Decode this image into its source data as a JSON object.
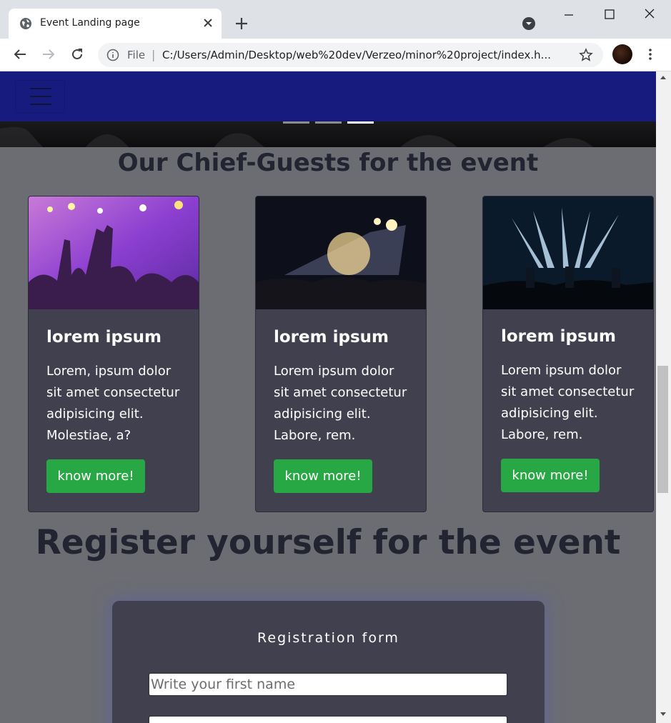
{
  "browser": {
    "tab_title": "Event Landing page",
    "omnibox_scheme": "File",
    "omnibox_url": "C:/Users/Admin/Desktop/web%20dev/Verzeo/minor%20project/index.h..."
  },
  "page": {
    "chief_guests_title": "Our Chief-Guests for the event",
    "cards": [
      {
        "title": "lorem ipsum",
        "text": "Lorem, ipsum dolor sit amet consectetur adipisicing elit. Molestiae, a?",
        "button": "know more!",
        "image": "concert-hands-purple-lights"
      },
      {
        "title": "lorem ipsum",
        "text": "Lorem ipsum dolor sit amet consectetur adipisicing elit. Labore, rem.",
        "button": "know more!",
        "image": "concert-stage-fireworks"
      },
      {
        "title": "lorem ipsum",
        "text": "Lorem ipsum dolor sit amet consectetur adipisicing elit. Labore, rem.",
        "button": "know more!",
        "image": "concert-band-spotlights"
      }
    ],
    "register_title": "Register yourself for the event",
    "form": {
      "title": "Registration form",
      "first_name_placeholder": "Write your first name",
      "second_field_placeholder": ""
    }
  },
  "colors": {
    "navbar": "#171b7e",
    "card_bg": "#41404f",
    "button_green": "#28a745",
    "page_bg": "#6c6d73"
  }
}
